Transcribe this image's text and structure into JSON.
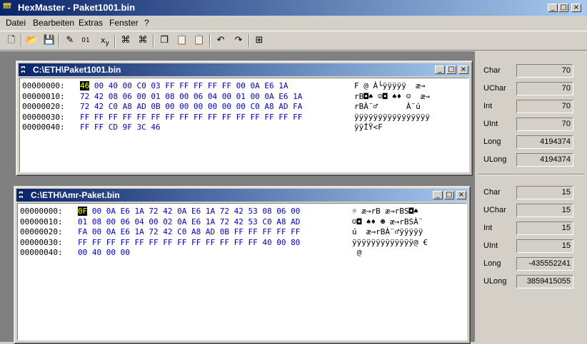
{
  "window": {
    "app_icon": "ffff",
    "title": "HexMaster - Paket1001.bin"
  },
  "menu": [
    "Datei",
    "Bearbeiten",
    "Extras",
    "Fenster",
    "?"
  ],
  "toolbar_icons": [
    "new-file-icon",
    "open-folder-icon",
    "save-disk-icon",
    "find-replace-icon",
    "convert-01-icon",
    "xy-icon",
    "binoculars-icon",
    "binoculars-next-icon",
    "copy-icon",
    "paste-icon",
    "paste-special-icon",
    "undo-icon",
    "redo-icon",
    "dialog-icon"
  ],
  "doc1": {
    "title": "C:\\ETH\\Paket1001.bin",
    "rows": [
      {
        "offset": "00000000:",
        "hex": [
          "46",
          "00",
          "40",
          "00",
          "C0",
          "03",
          "FF",
          "FF",
          "FF",
          "FF",
          "FF",
          "00",
          "0A",
          "E6",
          "1A"
        ],
        "ascii": "F @ À└ÿÿÿÿÿ  æ→"
      },
      {
        "offset": "00000010:",
        "hex": [
          "72",
          "42",
          "08",
          "06",
          "00",
          "01",
          "08",
          "00",
          "06",
          "04",
          "00",
          "01",
          "00",
          "0A",
          "E6",
          "1A"
        ],
        "ascii": "rB◘♠ ☺◘ ♠♦ ☺  æ→"
      },
      {
        "offset": "00000020:",
        "hex": [
          "72",
          "42",
          "C0",
          "A8",
          "AD",
          "0B",
          "00",
          "00",
          "00",
          "00",
          "00",
          "00",
          "C0",
          "A8",
          "AD",
          "FA"
        ],
        "ascii": "rBÀ¨­♂      À¨­ú"
      },
      {
        "offset": "00000030:",
        "hex": [
          "FF",
          "FF",
          "FF",
          "FF",
          "FF",
          "FF",
          "FF",
          "FF",
          "FF",
          "FF",
          "FF",
          "FF",
          "FF",
          "FF",
          "FF",
          "FF"
        ],
        "ascii": "ÿÿÿÿÿÿÿÿÿÿÿÿÿÿÿÿ"
      },
      {
        "offset": "00000040:",
        "hex": [
          "FF",
          "FF",
          "CD",
          "9F",
          "3C",
          "46"
        ],
        "ascii": "ÿÿÍŸ<F"
      }
    ]
  },
  "doc2": {
    "title": "C:\\ETH\\Amr-Paket.bin",
    "rows": [
      {
        "offset": "00000000:",
        "hex": [
          "0F",
          "00",
          "0A",
          "E6",
          "1A",
          "72",
          "42",
          "0A",
          "E6",
          "1A",
          "72",
          "42",
          "53",
          "08",
          "06",
          "00"
        ],
        "ascii": "☼ æ→rB æ→rBS◘♠ "
      },
      {
        "offset": "00000010:",
        "hex": [
          "01",
          "08",
          "00",
          "06",
          "04",
          "00",
          "02",
          "0A",
          "E6",
          "1A",
          "72",
          "42",
          "53",
          "C0",
          "A8",
          "AD"
        ],
        "ascii": "☺◘ ♠♦ ☻ æ→rBSÀ¨­"
      },
      {
        "offset": "00000020:",
        "hex": [
          "FA",
          "00",
          "0A",
          "E6",
          "1A",
          "72",
          "42",
          "C0",
          "A8",
          "AD",
          "0B",
          "FF",
          "FF",
          "FF",
          "FF",
          "FF"
        ],
        "ascii": "ú  æ→rBÀ¨­♂ÿÿÿÿÿ"
      },
      {
        "offset": "00000030:",
        "hex": [
          "FF",
          "FF",
          "FF",
          "FF",
          "FF",
          "FF",
          "FF",
          "FF",
          "FF",
          "FF",
          "FF",
          "FF",
          "FF",
          "40",
          "00",
          "80"
        ],
        "ascii": "ÿÿÿÿÿÿÿÿÿÿÿÿÿ@ €"
      },
      {
        "offset": "00000040:",
        "hex": [
          "00",
          "40",
          "00",
          "00"
        ],
        "ascii": " @"
      }
    ]
  },
  "panel1": [
    {
      "label": "Char",
      "value": "70"
    },
    {
      "label": "UChar",
      "value": "70"
    },
    {
      "label": "Int",
      "value": "70"
    },
    {
      "label": "UInt",
      "value": "70"
    },
    {
      "label": "Long",
      "value": "4194374"
    },
    {
      "label": "ULong",
      "value": "4194374"
    }
  ],
  "panel2": [
    {
      "label": "Char",
      "value": "15"
    },
    {
      "label": "UChar",
      "value": "15"
    },
    {
      "label": "Int",
      "value": "15"
    },
    {
      "label": "UInt",
      "value": "15"
    },
    {
      "label": "Long",
      "value": "-435552241"
    },
    {
      "label": "ULong",
      "value": "3859415055"
    }
  ]
}
